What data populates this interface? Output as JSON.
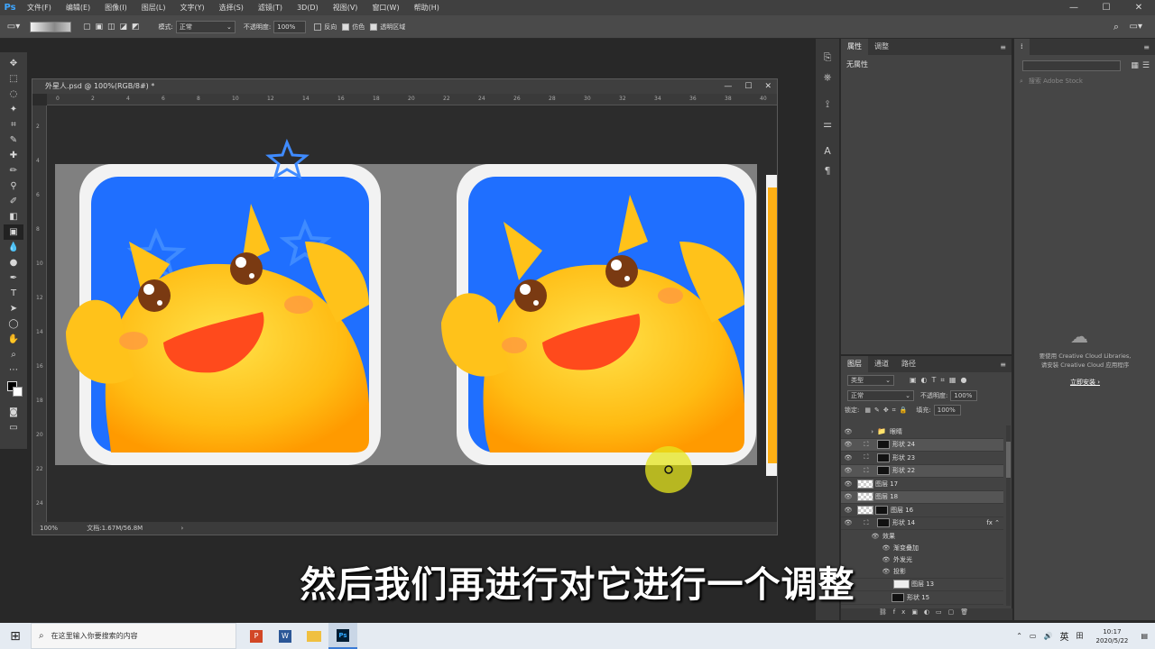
{
  "app": {
    "logo": "Ps"
  },
  "menu": [
    "文件(F)",
    "编辑(E)",
    "图像(I)",
    "图层(L)",
    "文字(Y)",
    "选择(S)",
    "滤镜(T)",
    "3D(D)",
    "视图(V)",
    "窗口(W)",
    "帮助(H)"
  ],
  "window_controls": [
    "—",
    "☐",
    "✕"
  ],
  "options": {
    "mode_label": "模式:",
    "mode_value": "正常",
    "opacity_label": "不透明度:",
    "opacity_value": "100%",
    "reverse_label": "反向",
    "dither_label": "仿色",
    "transparency_label": "透明区域"
  },
  "document": {
    "title": "外星人.psd @ 100%(RGB/8#) *",
    "controls": [
      "—",
      "☐",
      "✕"
    ],
    "zoom": "100%",
    "file_info": "文档:1.67M/56.8M",
    "hruler": [
      "0",
      "2",
      "4",
      "6",
      "8",
      "10",
      "12",
      "14",
      "16",
      "18",
      "20",
      "22",
      "24",
      "26",
      "28",
      "30",
      "32",
      "34",
      "36",
      "38",
      "40"
    ],
    "vruler": [
      "2",
      "4",
      "6",
      "8",
      "10",
      "12",
      "14",
      "16",
      "18",
      "20",
      "22",
      "24"
    ]
  },
  "properties_panel": {
    "tabs": [
      "属性",
      "调整"
    ],
    "content": "无属性"
  },
  "libraries_panel": {
    "search_placeholder": "搜索 Adobe Stock",
    "message_line1": "要使用 Creative Cloud Libraries,",
    "message_line2": "请安装 Creative Cloud 应用程序",
    "link": "立即安装 ›"
  },
  "layers_panel": {
    "tabs": [
      "图层",
      "通道",
      "路径"
    ],
    "filter_value": "类型",
    "blend_mode": "正常",
    "opacity_label": "不透明度:",
    "opacity_value": "100%",
    "lock_label": "锁定:",
    "fill_label": "填充:",
    "fill_value": "100%",
    "layers": [
      {
        "name": "眼睛",
        "type": "group"
      },
      {
        "name": "形状 24",
        "type": "shape"
      },
      {
        "name": "形状 23",
        "type": "shape"
      },
      {
        "name": "形状 22",
        "type": "shape"
      },
      {
        "name": "图层 17",
        "type": "pixel"
      },
      {
        "name": "图层 18",
        "type": "pixel"
      },
      {
        "name": "图层 16",
        "type": "pixel"
      },
      {
        "name": "形状 14",
        "type": "shape"
      },
      {
        "name": "效果",
        "type": "effects"
      },
      {
        "name": "渐变叠加",
        "type": "effect"
      },
      {
        "name": "外发光",
        "type": "effect"
      },
      {
        "name": "投影",
        "type": "effect"
      },
      {
        "name": "图层 13",
        "type": "pixel"
      },
      {
        "name": "形状 15",
        "type": "shape"
      }
    ]
  },
  "subtitle": "然后我们再进行对它进行一个调整",
  "taskbar": {
    "search_placeholder": "在这里输入你要搜索的内容",
    "ime": "英",
    "time": "10:17",
    "date": "2020/5/22"
  },
  "colors": {
    "accent_blue": "#1f6fff",
    "character_yellow": "#ffc21a",
    "cursor_highlight": "#e6e61e"
  }
}
